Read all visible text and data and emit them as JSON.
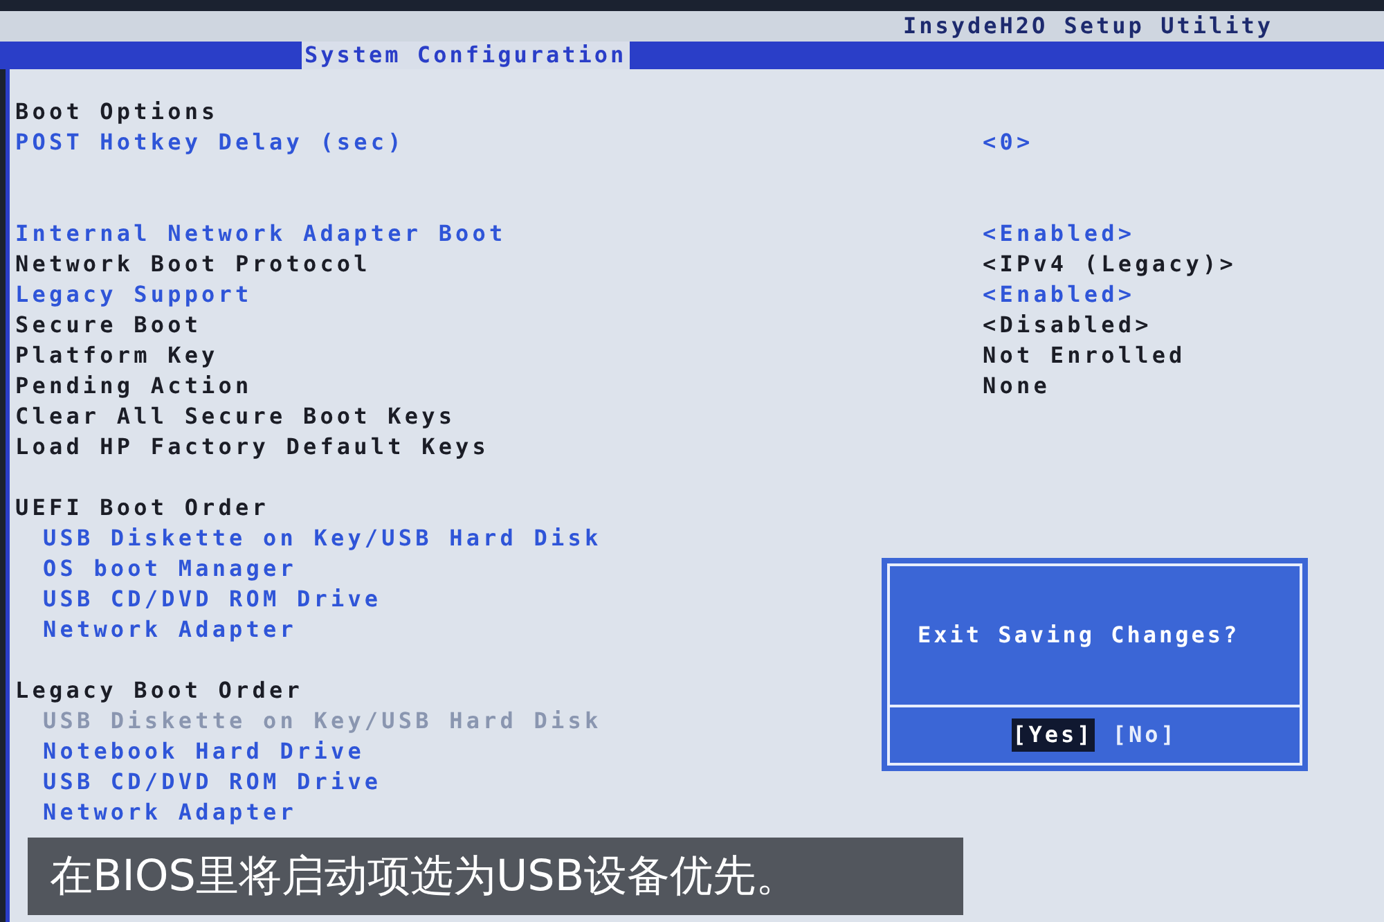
{
  "header": {
    "title": "InsydeH2O Setup Utility",
    "tabs": [
      {
        "label": "System Configuration",
        "selected": true
      }
    ]
  },
  "sections": [
    {
      "heading": "Boot Options",
      "kind": "settings",
      "groups": [
        {
          "items": [
            {
              "label": "POST Hotkey Delay (sec)",
              "value": "<0>",
              "editable": true,
              "selected": false
            }
          ]
        },
        {
          "items": [
            {
              "label": "Internal Network Adapter Boot",
              "value": "<Enabled>",
              "editable": true,
              "selected": false
            },
            {
              "label": "Network Boot Protocol",
              "value": "<IPv4 (Legacy)>",
              "editable": false,
              "selected": false
            },
            {
              "label": "Legacy Support",
              "value": "<Enabled>",
              "editable": true,
              "selected": false
            },
            {
              "label": "Secure Boot",
              "value": "<Disabled>",
              "editable": false,
              "selected": false
            },
            {
              "label": "Platform Key",
              "value": "Not Enrolled",
              "editable": false,
              "selected": false
            },
            {
              "label": "Pending Action",
              "value": "None",
              "editable": false,
              "selected": false
            },
            {
              "label": "Clear All Secure Boot Keys",
              "editable": false,
              "selected": false
            },
            {
              "label": "Load HP Factory Default Keys",
              "editable": false,
              "selected": false
            }
          ]
        }
      ]
    },
    {
      "heading": "UEFI Boot Order",
      "kind": "boot_order",
      "groups": [
        {
          "items": [
            {
              "label": "USB Diskette on Key/USB Hard Disk",
              "editable": true,
              "selected": false
            },
            {
              "label": "OS boot Manager",
              "editable": true,
              "selected": false
            },
            {
              "label": "USB CD/DVD ROM Drive",
              "editable": true,
              "selected": false
            },
            {
              "label": "Network Adapter",
              "editable": true,
              "selected": false
            }
          ]
        }
      ]
    },
    {
      "heading": "Legacy Boot Order",
      "kind": "boot_order",
      "groups": [
        {
          "items": [
            {
              "label": "USB Diskette on Key/USB Hard Disk",
              "editable": true,
              "selected": true
            },
            {
              "label": "Notebook Hard Drive",
              "editable": true,
              "selected": false
            },
            {
              "label": "USB CD/DVD ROM Drive",
              "editable": true,
              "selected": false
            },
            {
              "label": "Network Adapter",
              "editable": true,
              "selected": false
            }
          ]
        }
      ]
    }
  ],
  "dialog": {
    "message": "Exit Saving Changes?",
    "buttons": [
      {
        "label": "[Yes]",
        "selected": true
      },
      {
        "label": "[No]",
        "selected": false
      }
    ]
  },
  "caption": "在BIOS里将启动项选为USB设备优先。"
}
